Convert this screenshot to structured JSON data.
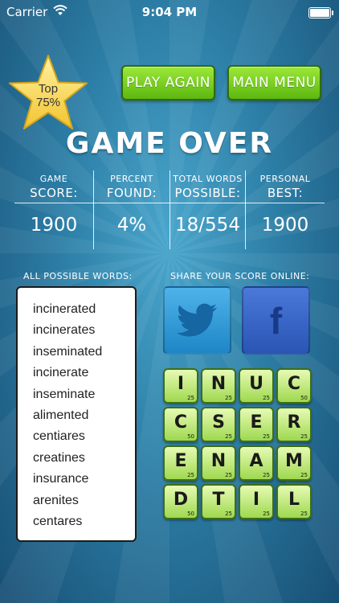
{
  "status_bar": {
    "carrier": "Carrier",
    "time": "9:04 PM"
  },
  "badge": {
    "line1": "Top",
    "line2": "75%",
    "color": "#f9d548"
  },
  "buttons": {
    "play_again": "PLAY AGAIN",
    "main_menu": "MAIN MENU"
  },
  "title": "GAME OVER",
  "stats": [
    {
      "label1": "GAME",
      "label2": "SCORE:",
      "value": "1900"
    },
    {
      "label1": "PERCENT",
      "label2": "FOUND:",
      "value": "4%"
    },
    {
      "label1": "TOTAL WORDS",
      "label2": "POSSIBLE:",
      "value": "18/554"
    },
    {
      "label1": "PERSONAL",
      "label2": "BEST:",
      "value": "1900"
    }
  ],
  "words_section": {
    "label": "ALL POSSIBLE WORDS:",
    "words": [
      "incinerated",
      "incinerates",
      "inseminated",
      "incinerate",
      "inseminate",
      "alimented",
      "centiares",
      "creatines",
      "insurance",
      "arenites",
      "centares"
    ]
  },
  "share_section": {
    "label": "SHARE YOUR SCORE ONLINE:",
    "twitter_icon": "twitter-bird-icon",
    "facebook_letter": "f"
  },
  "board": {
    "rows": [
      [
        {
          "letter": "I",
          "points": "25"
        },
        {
          "letter": "N",
          "points": "25"
        },
        {
          "letter": "U",
          "points": "25"
        },
        {
          "letter": "C",
          "points": "50"
        }
      ],
      [
        {
          "letter": "C",
          "points": "50"
        },
        {
          "letter": "S",
          "points": "25"
        },
        {
          "letter": "E",
          "points": "25"
        },
        {
          "letter": "R",
          "points": "25"
        }
      ],
      [
        {
          "letter": "E",
          "points": "25"
        },
        {
          "letter": "N",
          "points": "25"
        },
        {
          "letter": "A",
          "points": "25"
        },
        {
          "letter": "M",
          "points": "25"
        }
      ],
      [
        {
          "letter": "D",
          "points": "50"
        },
        {
          "letter": "T",
          "points": "25"
        },
        {
          "letter": "I",
          "points": "25"
        },
        {
          "letter": "L",
          "points": "25"
        }
      ]
    ]
  },
  "colors": {
    "accent_green": "#7ed321",
    "background_blue": "#2f7fa6",
    "twitter_blue": "#2aa2e0",
    "facebook_blue": "#3b66c8",
    "tile_green": "#c8f087"
  }
}
